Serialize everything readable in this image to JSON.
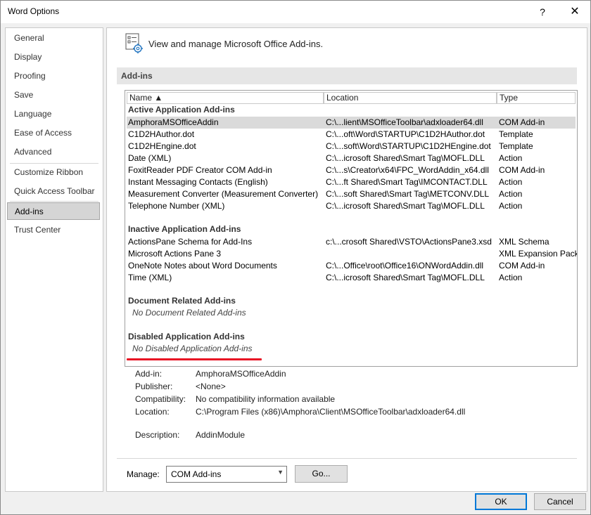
{
  "window": {
    "title": "Word Options",
    "help_glyph": "?",
    "close_glyph": "✕"
  },
  "nav": {
    "items": [
      {
        "label": "General"
      },
      {
        "label": "Display"
      },
      {
        "label": "Proofing"
      },
      {
        "label": "Save"
      },
      {
        "label": "Language"
      },
      {
        "label": "Ease of Access"
      },
      {
        "label": "Advanced"
      },
      {
        "label": "Customize Ribbon"
      },
      {
        "label": "Quick Access Toolbar"
      },
      {
        "label": "Add-ins"
      },
      {
        "label": "Trust Center"
      }
    ],
    "active": "Add-ins"
  },
  "header": {
    "heading": "View and manage Microsoft Office Add-ins.",
    "section": "Add-ins"
  },
  "table": {
    "columns": [
      "Name ▲",
      "Location",
      "Type"
    ],
    "groups": {
      "active": "Active Application Add-ins",
      "inactive": "Inactive Application Add-ins",
      "document": "Document Related Add-ins",
      "disabled": "Disabled Application Add-ins"
    },
    "active_rows": [
      {
        "name": "AmphoraMSOfficeAddin",
        "location": "C:\\...lient\\MSOfficeToolbar\\adxloader64.dll",
        "type": "COM Add-in"
      },
      {
        "name": "C1D2HAuthor.dot",
        "location": "C:\\...oft\\Word\\STARTUP\\C1D2HAuthor.dot",
        "type": "Template"
      },
      {
        "name": "C1D2HEngine.dot",
        "location": "C:\\...soft\\Word\\STARTUP\\C1D2HEngine.dot",
        "type": "Template"
      },
      {
        "name": "Date (XML)",
        "location": "C:\\...icrosoft Shared\\Smart Tag\\MOFL.DLL",
        "type": "Action"
      },
      {
        "name": "FoxitReader PDF Creator COM Add-in",
        "location": "C:\\...s\\Creator\\x64\\FPC_WordAddin_x64.dll",
        "type": "COM Add-in"
      },
      {
        "name": "Instant Messaging Contacts (English)",
        "location": "C:\\...ft Shared\\Smart Tag\\IMCONTACT.DLL",
        "type": "Action"
      },
      {
        "name": "Measurement Converter (Measurement Converter)",
        "location": "C:\\...soft Shared\\Smart Tag\\METCONV.DLL",
        "type": "Action"
      },
      {
        "name": "Telephone Number (XML)",
        "location": "C:\\...icrosoft Shared\\Smart Tag\\MOFL.DLL",
        "type": "Action"
      }
    ],
    "inactive_rows": [
      {
        "name": "ActionsPane Schema for Add-Ins",
        "location": "c:\\...crosoft Shared\\VSTO\\ActionsPane3.xsd",
        "type": "XML Schema"
      },
      {
        "name": "Microsoft Actions Pane 3",
        "location": "",
        "type": "XML Expansion Pack"
      },
      {
        "name": "OneNote Notes about Word Documents",
        "location": "C:\\...Office\\root\\Office16\\ONWordAddin.dll",
        "type": "COM Add-in"
      },
      {
        "name": "Time (XML)",
        "location": "C:\\...icrosoft Shared\\Smart Tag\\MOFL.DLL",
        "type": "Action"
      }
    ],
    "document_empty": "No Document Related Add-ins",
    "disabled_empty": "No Disabled Application Add-ins"
  },
  "details": {
    "addin_label": "Add-in:",
    "addin_value": "AmphoraMSOfficeAddin",
    "publisher_label": "Publisher:",
    "publisher_value": "<None>",
    "compat_label": "Compatibility:",
    "compat_value": "No compatibility information available",
    "location_label": "Location:",
    "location_value": "C:\\Program Files (x86)\\Amphora\\Client\\MSOfficeToolbar\\adxloader64.dll",
    "desc_label": "Description:",
    "desc_value": "AddinModule"
  },
  "manage": {
    "label": "Manage:",
    "selected": "COM Add-ins",
    "go_label": "Go..."
  },
  "buttons": {
    "ok": "OK",
    "cancel": "Cancel"
  },
  "colors": {
    "accent": "#0078d7",
    "highlight_underline": "#e81123",
    "selected_row": "#dadada"
  }
}
